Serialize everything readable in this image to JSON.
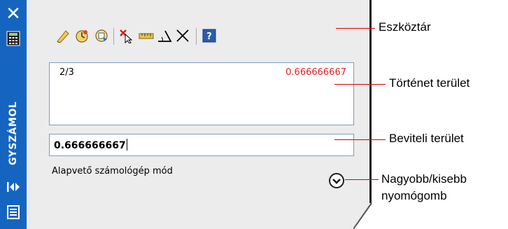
{
  "sidebar": {
    "title": "GYSZÁMOL",
    "icons": [
      "close-icon",
      "calculator-icon",
      "collapse-panel-icon",
      "menu-icon"
    ],
    "color": "#1565c0"
  },
  "toolbar": {
    "buttons": [
      "clear-eraser-icon",
      "history-clear-icon",
      "paste-to-command-icon",
      "get-coordinates-icon",
      "distance-measure-icon",
      "angle-between-lines-icon",
      "intersection-icon",
      "help-icon"
    ]
  },
  "history": {
    "entries": [
      {
        "expression": "2/3",
        "result": "0.666666667"
      }
    ],
    "result_color": "#e52020"
  },
  "input": {
    "value": "0.666666667"
  },
  "mode": {
    "label": "Alapvető számológép mód"
  },
  "callouts": {
    "toolbar": "Eszköztár",
    "history": "Történet terület",
    "input": "Beviteli terület",
    "toggle_line1": "Nagyobb/kisebb",
    "toggle_line2": "nyomógomb"
  },
  "colors": {
    "leader_line": "#e00000",
    "panel_bg": "#ececec"
  }
}
